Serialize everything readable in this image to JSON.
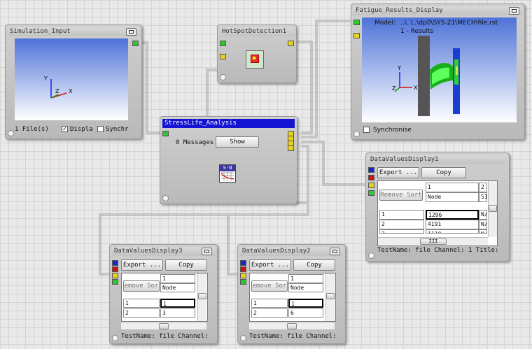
{
  "windows": {
    "simulation_input": {
      "title": "Simulation_Input",
      "status_text": "1 File(s)",
      "display_label": "Displa",
      "display_checked": true,
      "sync_label": "Synchr",
      "sync_checked": false,
      "axes": {
        "y": "Y",
        "z": "Z",
        "x": "X"
      }
    },
    "hotspot": {
      "title": "HotSpotDetection1"
    },
    "stresslife": {
      "title": "StressLife_Analysis",
      "messages": "0 Messages",
      "show_label": "Show",
      "icon_text": "S-N"
    },
    "fatigue": {
      "title": "Fatigue_Results_Display",
      "model_label": "Model:",
      "model_path": "..\\..\\..\\dp0\\SYS-21\\MECH\\file.rst",
      "results_label": "1 - Results",
      "sync_label": "Synchronise",
      "sync_checked": false,
      "axes": {
        "y": "Y",
        "z": "Z",
        "x": "X"
      }
    },
    "dv1": {
      "title": "DataValuesDisplay1",
      "export_label": "Export ...",
      "copy_label": "Copy",
      "remove_sort_label": "Remove Sort",
      "header_col1_top": "1",
      "header_col1_bottom": "Node",
      "header_col2_top": "2",
      "header_col2_bottom": "S1",
      "rows": [
        {
          "idx": "1",
          "val": "1296",
          "extra": "N/"
        },
        {
          "idx": "2",
          "val": "4191",
          "extra": "N/"
        },
        {
          "idx": "3",
          "val": "1110",
          "extra": "N/"
        }
      ],
      "status_text": "TestName: file  Channel: 1  Title:",
      "scroll_glyph": "III"
    },
    "dv3": {
      "title": "DataValuesDisplay3",
      "export_label": "Export ...",
      "copy_label": "Copy",
      "remove_sort_label": "emove Sor",
      "header_top": "1",
      "header_bottom": "Node",
      "rows": [
        {
          "idx": "1",
          "val": "1"
        },
        {
          "idx": "2",
          "val": "3"
        }
      ],
      "status_text": "TestName: file  Channel:"
    },
    "dv2": {
      "title": "DataValuesDisplay2",
      "export_label": "Export ...",
      "copy_label": "Copy",
      "remove_sort_label": "emove Sor",
      "header_top": "1",
      "header_bottom": "Node",
      "rows": [
        {
          "idx": "1",
          "val": "1"
        },
        {
          "idx": "2",
          "val": "6"
        }
      ],
      "status_text": "TestName: file  Channel:"
    }
  },
  "colors": {
    "title_active": "#1414d2",
    "port_green": "#2ec82e",
    "port_yellow": "#e6d21e",
    "port_blue": "#1428c8",
    "port_red": "#c81414",
    "viewport_top": "#4e73d8"
  }
}
